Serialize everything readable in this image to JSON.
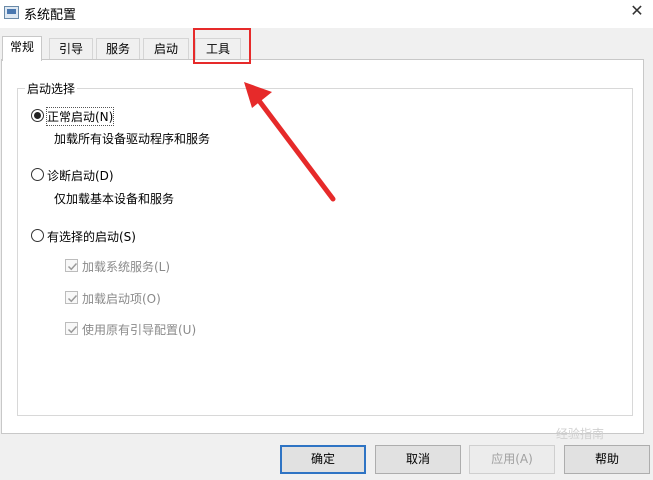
{
  "window": {
    "title": "系统配置"
  },
  "tabs": [
    {
      "label": "常规",
      "active": true
    },
    {
      "label": "引导"
    },
    {
      "label": "服务"
    },
    {
      "label": "启动"
    },
    {
      "label": "工具",
      "highlighted": true
    }
  ],
  "startup_selection": {
    "legend": "启动选择",
    "options": [
      {
        "label": "正常启动(N)",
        "description": "加载所有设备驱动程序和服务",
        "selected": true
      },
      {
        "label": "诊断启动(D)",
        "description": "仅加载基本设备和服务",
        "selected": false
      },
      {
        "label": "有选择的启动(S)",
        "selected": false
      }
    ],
    "selective_checkboxes": [
      {
        "label": "加载系统服务(L)",
        "checked": true,
        "disabled": true
      },
      {
        "label": "加载启动项(O)",
        "checked": true,
        "disabled": true
      },
      {
        "label": "使用原有引导配置(U)",
        "checked": true,
        "disabled": true
      }
    ]
  },
  "buttons": {
    "ok": "确定",
    "cancel": "取消",
    "apply": "应用(A)",
    "help": "帮助"
  },
  "annotation": {
    "color": "#e62a2a"
  },
  "watermark": "经验指南"
}
